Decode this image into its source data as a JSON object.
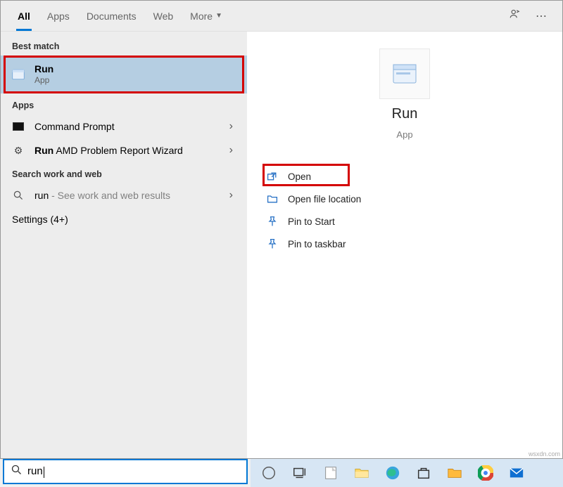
{
  "tabs": {
    "all": "All",
    "apps": "Apps",
    "documents": "Documents",
    "web": "Web",
    "more": "More"
  },
  "sections": {
    "best_match": "Best match",
    "apps": "Apps",
    "search_work_web": "Search work and web"
  },
  "results": {
    "run": {
      "title": "Run",
      "sub": "App"
    },
    "cmd": {
      "title": "Command Prompt"
    },
    "amd": {
      "prefix": "Run",
      "rest": " AMD Problem Report Wizard"
    },
    "web": {
      "term": "run",
      "suffix": " - See work and web results"
    },
    "settings": "Settings (4+)"
  },
  "preview": {
    "title": "Run",
    "sub": "App",
    "actions": {
      "open": "Open",
      "file_location": "Open file location",
      "pin_start": "Pin to Start",
      "pin_taskbar": "Pin to taskbar"
    }
  },
  "searchbar": {
    "query": "run"
  },
  "watermark": "wsxdn.com"
}
